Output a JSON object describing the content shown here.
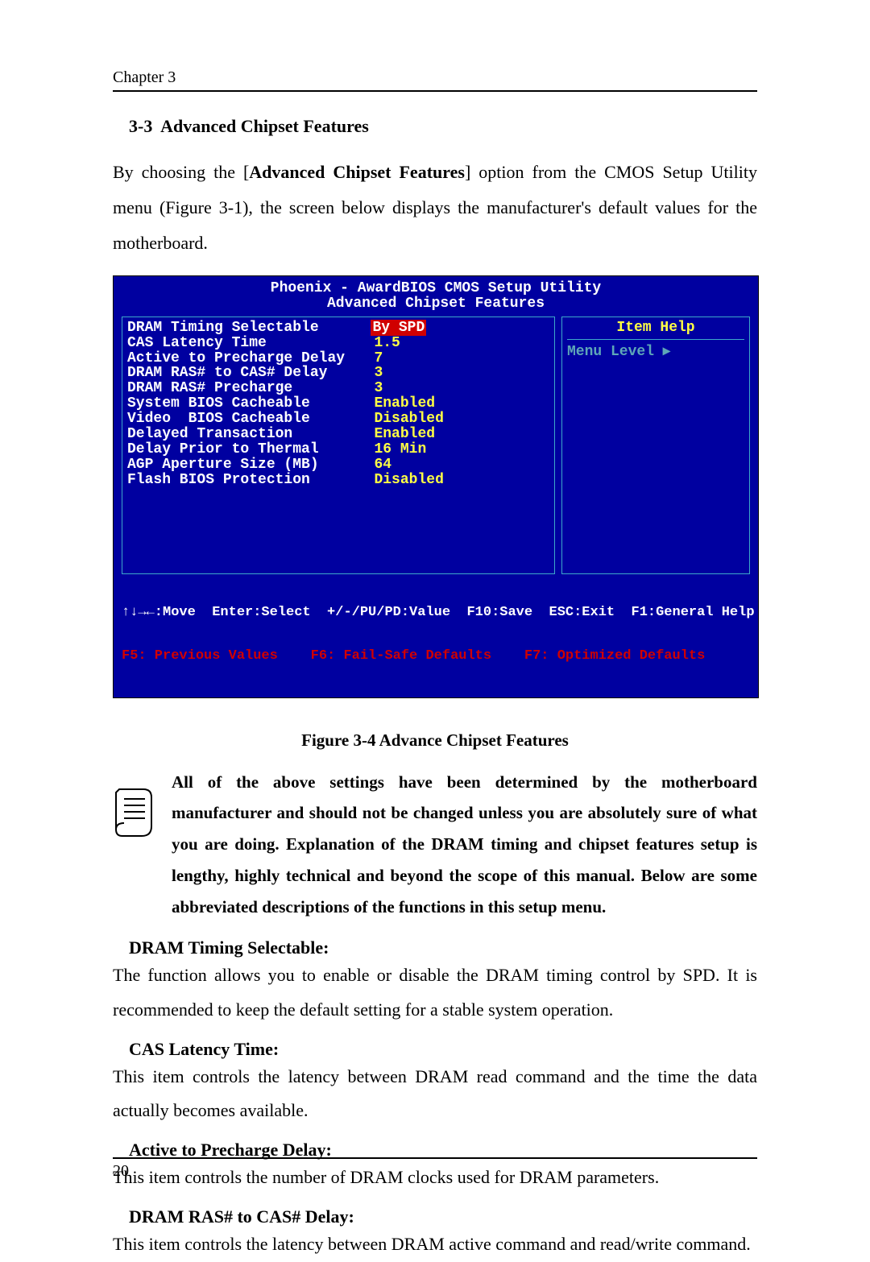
{
  "header": {
    "chapter": "Chapter 3"
  },
  "section": {
    "number": "3-3",
    "title": "Advanced Chipset Features",
    "intro_1": "By choosing the [",
    "intro_bold": "Advanced Chipset Features",
    "intro_2": "] option from the CMOS Setup Utility menu (Figure 3-1), the screen below displays the manufacturer's default values for the motherboard."
  },
  "bios": {
    "title": "Phoenix - AwardBIOS CMOS Setup Utility",
    "subtitle": "Advanced Chipset Features",
    "rows": [
      {
        "label": "DRAM Timing Selectable",
        "value": "By SPD",
        "selected": true
      },
      {
        "label": "CAS Latency Time",
        "value": "1.5"
      },
      {
        "label": "Active to Precharge Delay",
        "value": "7"
      },
      {
        "label": "DRAM RAS# to CAS# Delay",
        "value": "3"
      },
      {
        "label": "DRAM RAS# Precharge",
        "value": "3"
      },
      {
        "label": "System BIOS Cacheable",
        "value": "Enabled"
      },
      {
        "label": "Video  BIOS Cacheable",
        "value": "Disabled"
      },
      {
        "label": "Delayed Transaction",
        "value": "Enabled"
      },
      {
        "label": "Delay Prior to Thermal",
        "value": "16 Min"
      },
      {
        "label": "AGP Aperture Size (MB)",
        "value": "64"
      },
      {
        "label": "Flash BIOS Protection",
        "value": "Disabled"
      }
    ],
    "help_title": "Item Help",
    "menu_level": "Menu Level   ▸",
    "footer1": "↑↓→←:Move  Enter:Select  +/-/PU/PD:Value  F10:Save  ESC:Exit  F1:General Help",
    "footer2": "F5: Previous Values    F6: Fail-Safe Defaults    F7: Optimized Defaults"
  },
  "figure_caption": "Figure 3-4 Advance Chipset Features",
  "note": "All of the above settings have been determined by the motherboard manufacturer and should not be changed unless you are absolutely sure of what you are doing. Explanation of the DRAM timing and chipset features setup is lengthy, highly technical and beyond the scope of this manual. Below are some abbreviated descriptions of the functions in this setup menu.",
  "items": [
    {
      "heading": "DRAM Timing Selectable:",
      "text": "The function allows you to enable or disable the DRAM timing control by SPD. It is recommended to keep the default setting for a stable system operation."
    },
    {
      "heading": "CAS Latency Time:",
      "text": "This item controls the latency between DRAM read command and the time the data actually becomes available."
    },
    {
      "heading": "Active to Precharge Delay:",
      "text": "This item controls the number of DRAM clocks used for DRAM parameters."
    },
    {
      "heading": "DRAM RAS# to CAS# Delay:",
      "text": "This item controls the latency between DRAM active command and read/write command."
    }
  ],
  "page_number": "20"
}
